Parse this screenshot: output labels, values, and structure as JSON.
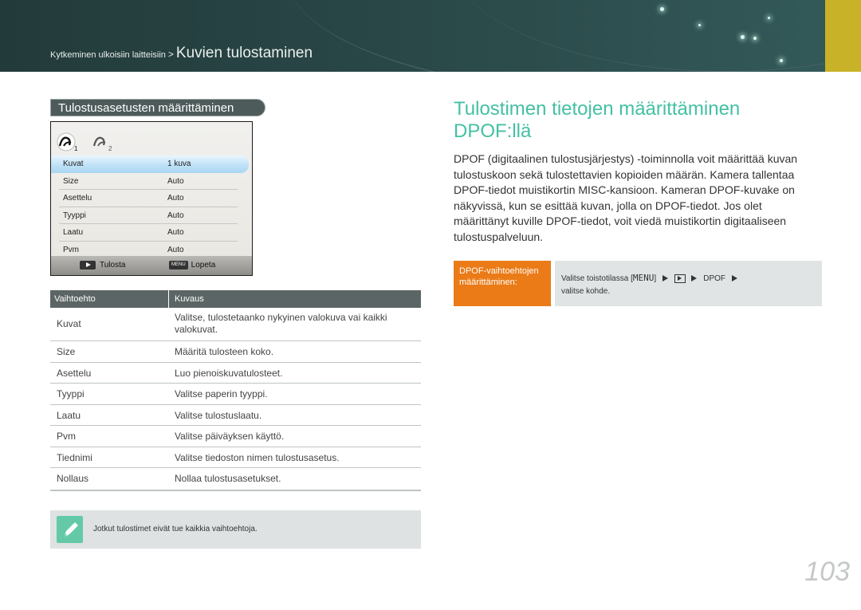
{
  "breadcrumb": {
    "parent": "Kytkeminen ulkoisiin laitteisiin",
    "separator": ">",
    "current": "Kuvien tulostaminen"
  },
  "left_section": {
    "title": "Tulostusasetusten määrittäminen"
  },
  "camera_screen": {
    "rows": [
      {
        "key": "Kuvat",
        "value": "1 kuva",
        "selected": true
      },
      {
        "key": "Size",
        "value": "Auto"
      },
      {
        "key": "Asettelu",
        "value": "Auto"
      },
      {
        "key": "Tyyppi",
        "value": "Auto"
      },
      {
        "key": "Laatu",
        "value": "Auto"
      },
      {
        "key": "Pvm",
        "value": "Auto"
      }
    ],
    "footer": {
      "print_label": "Tulosta",
      "menu_key": "MENU",
      "exit_label": "Lopeta"
    }
  },
  "options_table": {
    "headers": [
      "Vaihtoehto",
      "Kuvaus"
    ],
    "rows": [
      {
        "option": "Kuvat",
        "description": "Valitse, tulostetaanko nykyinen valokuva vai kaikki valokuvat."
      },
      {
        "option": "Size",
        "description": "Määritä tulosteen koko."
      },
      {
        "option": "Asettelu",
        "description": "Luo pienoiskuvatulosteet."
      },
      {
        "option": "Tyyppi",
        "description": "Valitse paperin tyyppi."
      },
      {
        "option": "Laatu",
        "description": "Valitse tulostuslaatu."
      },
      {
        "option": "Pvm",
        "description": "Valitse päiväyksen käyttö."
      },
      {
        "option": "Tiednimi",
        "description": "Valitse tiedoston nimen tulostusasetus."
      },
      {
        "option": "Nollaus",
        "description": "Nollaa tulostusasetukset."
      }
    ]
  },
  "note": {
    "text": "Jotkut tulostimet eivät tue kaikkia vaihtoehtoja."
  },
  "right_section": {
    "title_line1": "Tulostimen tietojen määrittäminen",
    "title_line2": "DPOF:llä",
    "body": "DPOF (digitaalinen tulostusjärjestys) -toiminnolla voit määrittää kuvan tulostuskoon sekä tulostettavien kopioiden määrän. Kamera tallentaa DPOF-tiedot muistikortin MISC-kansioon. Kameran DPOF-kuvake on näkyvissä, kun se esittää kuvan, jolla on DPOF-tiedot. Jos olet määrittänyt kuville DPOF-tiedot, voit viedä muistikortin digitaaliseen tulostuspalveluun.",
    "dpof_label": "DPOF-vaihtoehtojen määrittäminen:",
    "dpof_step_prefix": "Valitse toistotilassa [",
    "dpof_menu": "MENU",
    "dpof_step_mid": "]",
    "dpof_option": "DPOF",
    "dpof_step_suffix": "valitse kohde."
  },
  "page_number": "103",
  "colors": {
    "accent_teal": "#44c0a4",
    "accent_orange": "#ea7b17",
    "header_gold": "#c8b227"
  }
}
